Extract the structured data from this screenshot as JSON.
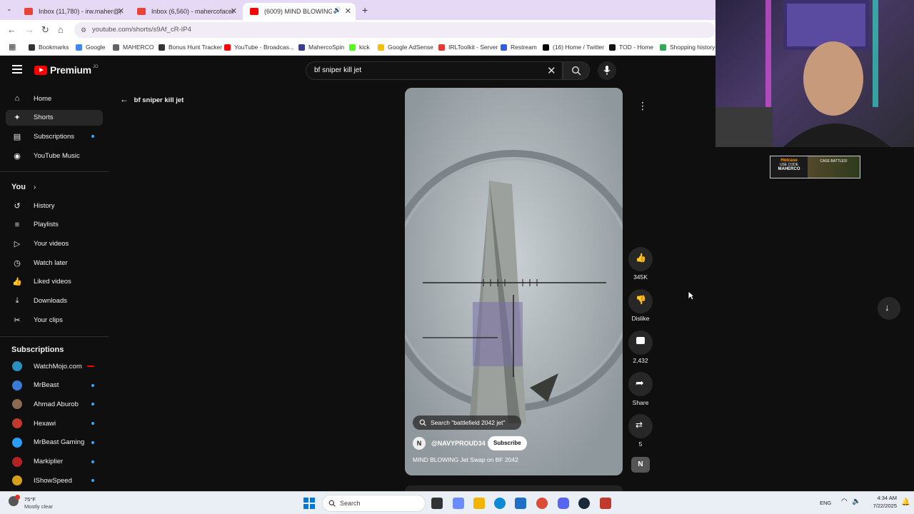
{
  "browser": {
    "tabs": [
      {
        "title": "Inbox (11,780) - irw.maher@gm",
        "active": false,
        "favicon_color": "#ea4335"
      },
      {
        "title": "Inbox (6,560) - mahercofacebo",
        "active": false,
        "favicon_color": "#ea4335"
      },
      {
        "title": "(6009) MIND BLOWING Jet",
        "active": true,
        "favicon_color": "#ff0000"
      }
    ],
    "new_tab": "+",
    "url": "youtube.com/shorts/s9Af_cR-IP4",
    "bookmarks": [
      {
        "label": "Bookmarks",
        "color": "#333"
      },
      {
        "label": "Google",
        "color": "#4285f4"
      },
      {
        "label": "MAHERCO",
        "color": "#5f6368"
      },
      {
        "label": "Bonus Hunt Tracker",
        "color": "#333"
      },
      {
        "label": "YouTube - Broadcas...",
        "color": "#ff0000"
      },
      {
        "label": "MahercoSpin",
        "color": "#3b3b8f"
      },
      {
        "label": "kick",
        "color": "#53fc18"
      },
      {
        "label": "Google AdSense",
        "color": "#fbbc04"
      },
      {
        "label": "IRLToolkit - Server",
        "color": "#e53935"
      },
      {
        "label": "Restream",
        "color": "#2f5de6"
      },
      {
        "label": "(16) Home / Twitter",
        "color": "#000"
      },
      {
        "label": "TOD - Home",
        "color": "#111"
      },
      {
        "label": "Shopping history",
        "color": "#34a853"
      }
    ]
  },
  "youtube": {
    "logo_text": "Premium",
    "logo_sup": "JO",
    "search_value": "bf sniper kill jet",
    "back_query": "bf sniper kill jet",
    "sidebar": {
      "main": [
        {
          "label": "Home",
          "icon": "⌂",
          "selected": false
        },
        {
          "label": "Shorts",
          "icon": "✦",
          "selected": true
        },
        {
          "label": "Subscriptions",
          "icon": "▤",
          "selected": false,
          "dot": true
        },
        {
          "label": "YouTube Music",
          "icon": "◉",
          "selected": false
        }
      ],
      "you_header": "You",
      "you": [
        {
          "label": "History",
          "icon": "↺"
        },
        {
          "label": "Playlists",
          "icon": "≡"
        },
        {
          "label": "Your videos",
          "icon": "▷"
        },
        {
          "label": "Watch later",
          "icon": "◷"
        },
        {
          "label": "Liked videos",
          "icon": "👍"
        },
        {
          "label": "Downloads",
          "icon": "⤓"
        },
        {
          "label": "Your clips",
          "icon": "✂"
        }
      ],
      "subs_header": "Subscriptions",
      "subscriptions": [
        {
          "label": "WatchMojo.com",
          "color": "#2a8fbf",
          "live": true
        },
        {
          "label": "MrBeast",
          "color": "#3a7bd5",
          "live": false
        },
        {
          "label": "Ahmad Aburob",
          "color": "#8a6a50",
          "live": false
        },
        {
          "label": "Hexawi",
          "color": "#c0392b",
          "live": false
        },
        {
          "label": "MrBeast Gaming",
          "color": "#2a9df4",
          "live": false
        },
        {
          "label": "Markiplier",
          "color": "#b22222",
          "live": false
        },
        {
          "label": "IShowSpeed",
          "color": "#d4a017",
          "live": false
        }
      ]
    },
    "short": {
      "search_chip": "Search \"battlefield 2042 jet\"",
      "channel": "@NAVYPROUD34",
      "subscribe": "Subscribe",
      "title": "MIND BLOWING Jet Swap on BF 2042",
      "likes": "345K",
      "dislike": "Dislike",
      "comments": "2,432",
      "share": "Share",
      "remix_count": "5"
    }
  },
  "overlay": {
    "badge_left": "Hotcase",
    "badge_code": "USE CODE",
    "badge_brand": "MAHERCO",
    "badge_right": "CASE BATTLES!"
  },
  "taskbar": {
    "weather_temp": "75°F",
    "weather_desc": "Mostly clear",
    "search": "Search",
    "lang": "ENG",
    "time": "4:34 AM",
    "date": "7/22/2025"
  }
}
